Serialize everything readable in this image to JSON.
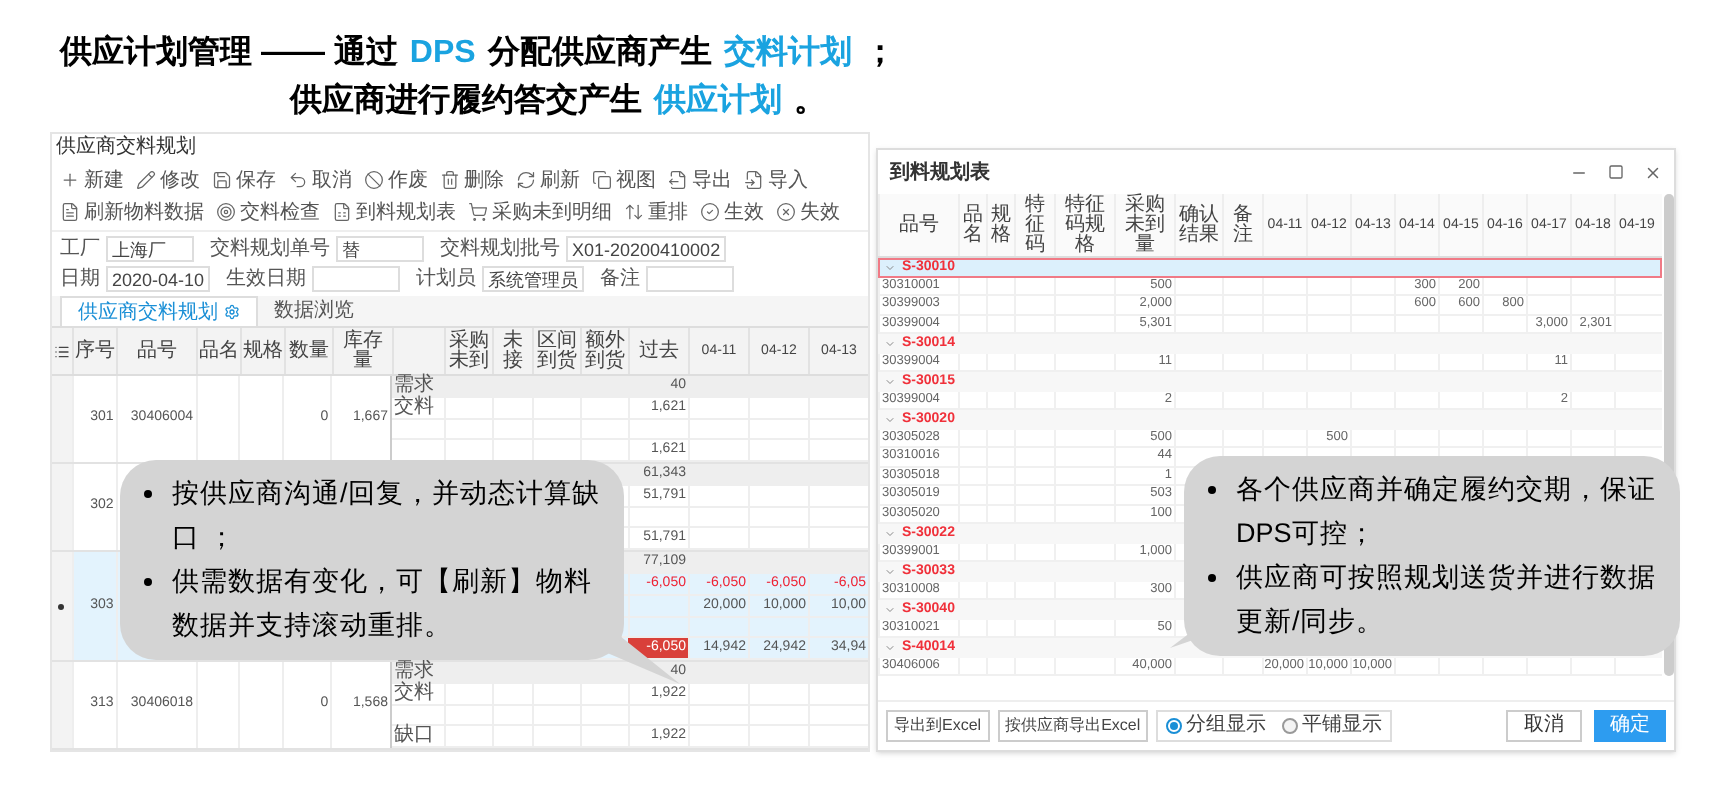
{
  "heading": [
    {
      "segments": [
        {
          "text": "供应计划管理 —— 通过",
          "highlight": false
        },
        {
          "text": "DPS",
          "highlight": true
        },
        {
          "text": "分配供应商产生",
          "highlight": false
        },
        {
          "text": "交料计划",
          "highlight": true
        },
        {
          "text": "；",
          "highlight": false
        }
      ]
    },
    {
      "segments": [
        {
          "text": "供应商进行履约答交产生",
          "highlight": false
        },
        {
          "text": "供应计划",
          "highlight": true
        },
        {
          "text": "。",
          "highlight": false
        }
      ]
    }
  ],
  "left_window": {
    "title": "供应商交料规划",
    "toolbar": [
      "新建",
      "修改",
      "保存",
      "取消",
      "作废",
      "删除",
      "刷新",
      "视图",
      "导出",
      "导入",
      "刷新物料数据",
      "交料检查",
      "到料规划表",
      "采购未到明细",
      "重排",
      "生效",
      "失效"
    ],
    "form": [
      {
        "label": "工厂",
        "value": "上海厂"
      },
      {
        "label": "交料规划单号",
        "value": "替"
      },
      {
        "label": "交料规划批号",
        "value": "X01-20200410002"
      },
      {
        "label": "日期",
        "value": "2020-04-10"
      },
      {
        "label": "生效日期"
      },
      {
        "label": "计划员",
        "value": "系统管理员"
      },
      {
        "label": "备注"
      }
    ],
    "tabs": [
      {
        "label": "供应商交料规划",
        "selected": true
      },
      {
        "label": "数据浏览",
        "selected": false
      }
    ],
    "item_columns": [
      "序号",
      "品号",
      "品名",
      "规格",
      "数量",
      "库存量"
    ],
    "detail_columns": [
      "采购未到",
      "未接",
      "区间到货",
      "额外到货",
      "过去",
      "04-11",
      "04-12",
      "04-13"
    ],
    "items": [
      {
        "no": "301",
        "code": "30406004",
        "qty": "0",
        "stock": "1,667",
        "selected": false,
        "rows": [
          {
            "label": "需求",
            "kind": "demand",
            "cells": {
              "past": "40"
            }
          },
          {
            "label": "交料",
            "kind": "plain",
            "cells": {
              "past": "1,621"
            }
          },
          {
            "kind": "plain"
          },
          {
            "kind": "plain",
            "cells": {
              "past": "1,621"
            }
          }
        ]
      },
      {
        "no": "302",
        "selected": false,
        "rows": [
          {
            "kind": "demand",
            "cells": {
              "past": "61,343"
            }
          },
          {
            "kind": "plain",
            "cells": {
              "past": "51,791"
            }
          },
          {
            "kind": "plain"
          },
          {
            "kind": "plain",
            "cells": {
              "past": "51,791"
            }
          }
        ]
      },
      {
        "no": "303",
        "selected": true,
        "rows": [
          {
            "kind": "demand",
            "cells": {
              "past": "77,109"
            }
          },
          {
            "kind": "shortage",
            "cells": {
              "past": "-6,050",
              "apr11": "-6,050",
              "apr12": "-6,050",
              "apr13": "-6,05"
            }
          },
          {
            "kind": "plain",
            "cells": {
              "apr11": "20,000",
              "apr12": "10,000",
              "apr13": "10,00"
            }
          },
          {
            "kind": "plain"
          },
          {
            "kind": "plain",
            "alert": true,
            "cells": {
              "past": "-6,050",
              "apr11": "14,942",
              "apr12": "24,942",
              "apr13": "34,94"
            }
          }
        ]
      },
      {
        "no": "313",
        "code": "30406018",
        "qty": "0",
        "stock": "1,568",
        "selected": false,
        "rows": [
          {
            "label": "需求",
            "kind": "demand",
            "cells": {
              "past": "40"
            }
          },
          {
            "label": "交料",
            "kind": "plain",
            "cells": {
              "past": "1,922"
            }
          },
          {
            "kind": "plain"
          },
          {
            "label": "缺口",
            "kind": "plain",
            "cells": {
              "past": "1,922"
            }
          }
        ]
      }
    ]
  },
  "dialog": {
    "title": "到料规划表",
    "columns": [
      "品号",
      "品名",
      "规格",
      "特征码",
      "特征码规格",
      "采购未到量",
      "确认结果",
      "备注",
      "04-11",
      "04-12",
      "04-13",
      "04-14",
      "04-15",
      "04-16",
      "04-17",
      "04-18",
      "04-19"
    ],
    "groups": [
      {
        "label": "S-30010",
        "selected": true,
        "rows": [
          {
            "code": "30310001",
            "qty": "500",
            "dates": {
              "apr14": "300",
              "apr15": "200"
            }
          },
          {
            "code": "30399003",
            "qty": "2,000",
            "dates": {
              "apr14": "600",
              "apr15": "600",
              "apr16": "800"
            }
          },
          {
            "code": "30399004",
            "qty": "5,301",
            "dates": {
              "apr17": "3,000",
              "apr18": "2,301"
            }
          }
        ]
      },
      {
        "label": "S-30014",
        "selected": false,
        "rows": [
          {
            "code": "30399004",
            "qty": "11",
            "dates": {
              "apr17": "11"
            }
          }
        ]
      },
      {
        "label": "S-30015",
        "selected": false,
        "rows": [
          {
            "code": "30399004",
            "qty": "2",
            "dates": {
              "apr17": "2"
            }
          }
        ]
      },
      {
        "label": "S-30020",
        "selected": false,
        "rows": [
          {
            "code": "30305028",
            "qty": "500",
            "dates": {
              "apr12": "500"
            }
          },
          {
            "code": "30310016",
            "qty": "44"
          },
          {
            "code": "30305018",
            "qty": "1"
          },
          {
            "code": "30305019",
            "qty": "503"
          },
          {
            "code": "30305020",
            "qty": "100"
          }
        ]
      },
      {
        "label": "S-30022",
        "selected": false,
        "rows": [
          {
            "code": "30399001",
            "qty": "1,000"
          }
        ]
      },
      {
        "label": "S-30033",
        "selected": false,
        "rows": [
          {
            "code": "30310008",
            "qty": "300"
          }
        ]
      },
      {
        "label": "S-30040",
        "selected": false,
        "rows": [
          {
            "code": "30310021",
            "qty": "50"
          }
        ]
      },
      {
        "label": "S-40014",
        "selected": false,
        "rows": [
          {
            "code": "30406006",
            "qty": "40,000",
            "dates": {
              "apr11": "20,000",
              "apr12": "10,000",
              "apr13": "10,000"
            }
          }
        ]
      }
    ],
    "export_buttons": [
      "导出到Excel",
      "按供应商导出Excel"
    ],
    "view_options": [
      {
        "label": "分组显示",
        "selected": true
      },
      {
        "label": "平铺显示",
        "selected": false
      }
    ],
    "cancel": "取消",
    "confirm": "确定"
  },
  "callouts": [
    {
      "bullets": [
        "按供应商沟通/回复，并动态计算缺口 ；",
        "供需数据有变化，可【刷新】物料数据并支持滚动重排。"
      ]
    },
    {
      "bullets": [
        "各个供应商并确定履约交期，保证DPS可控；",
        "供应商可按照规划送货并进行数据更新/同步。"
      ]
    }
  ]
}
